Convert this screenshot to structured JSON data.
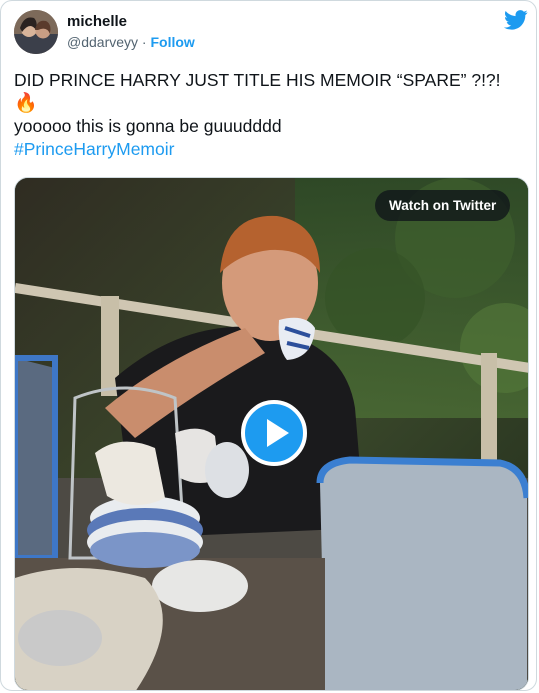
{
  "user": {
    "display_name": "michelle",
    "handle": "@ddarveyy",
    "separator": "·",
    "follow_label": "Follow"
  },
  "tweet": {
    "line1": "DID PRINCE HARRY JUST TITLE HIS MEMOIR  “SPARE” ?!?!",
    "emoji": "🔥",
    "line2": "yooooo this is gonna be guuudddd",
    "hashtag": "#PrinceHarryMemoir"
  },
  "media": {
    "watch_label": "Watch on Twitter"
  },
  "colors": {
    "accent": "#1d9bf0",
    "text": "#0f1419",
    "secondary": "#536471",
    "border": "#cfd9de"
  },
  "icons": {
    "brand": "twitter-bird-icon",
    "play": "play-icon"
  }
}
